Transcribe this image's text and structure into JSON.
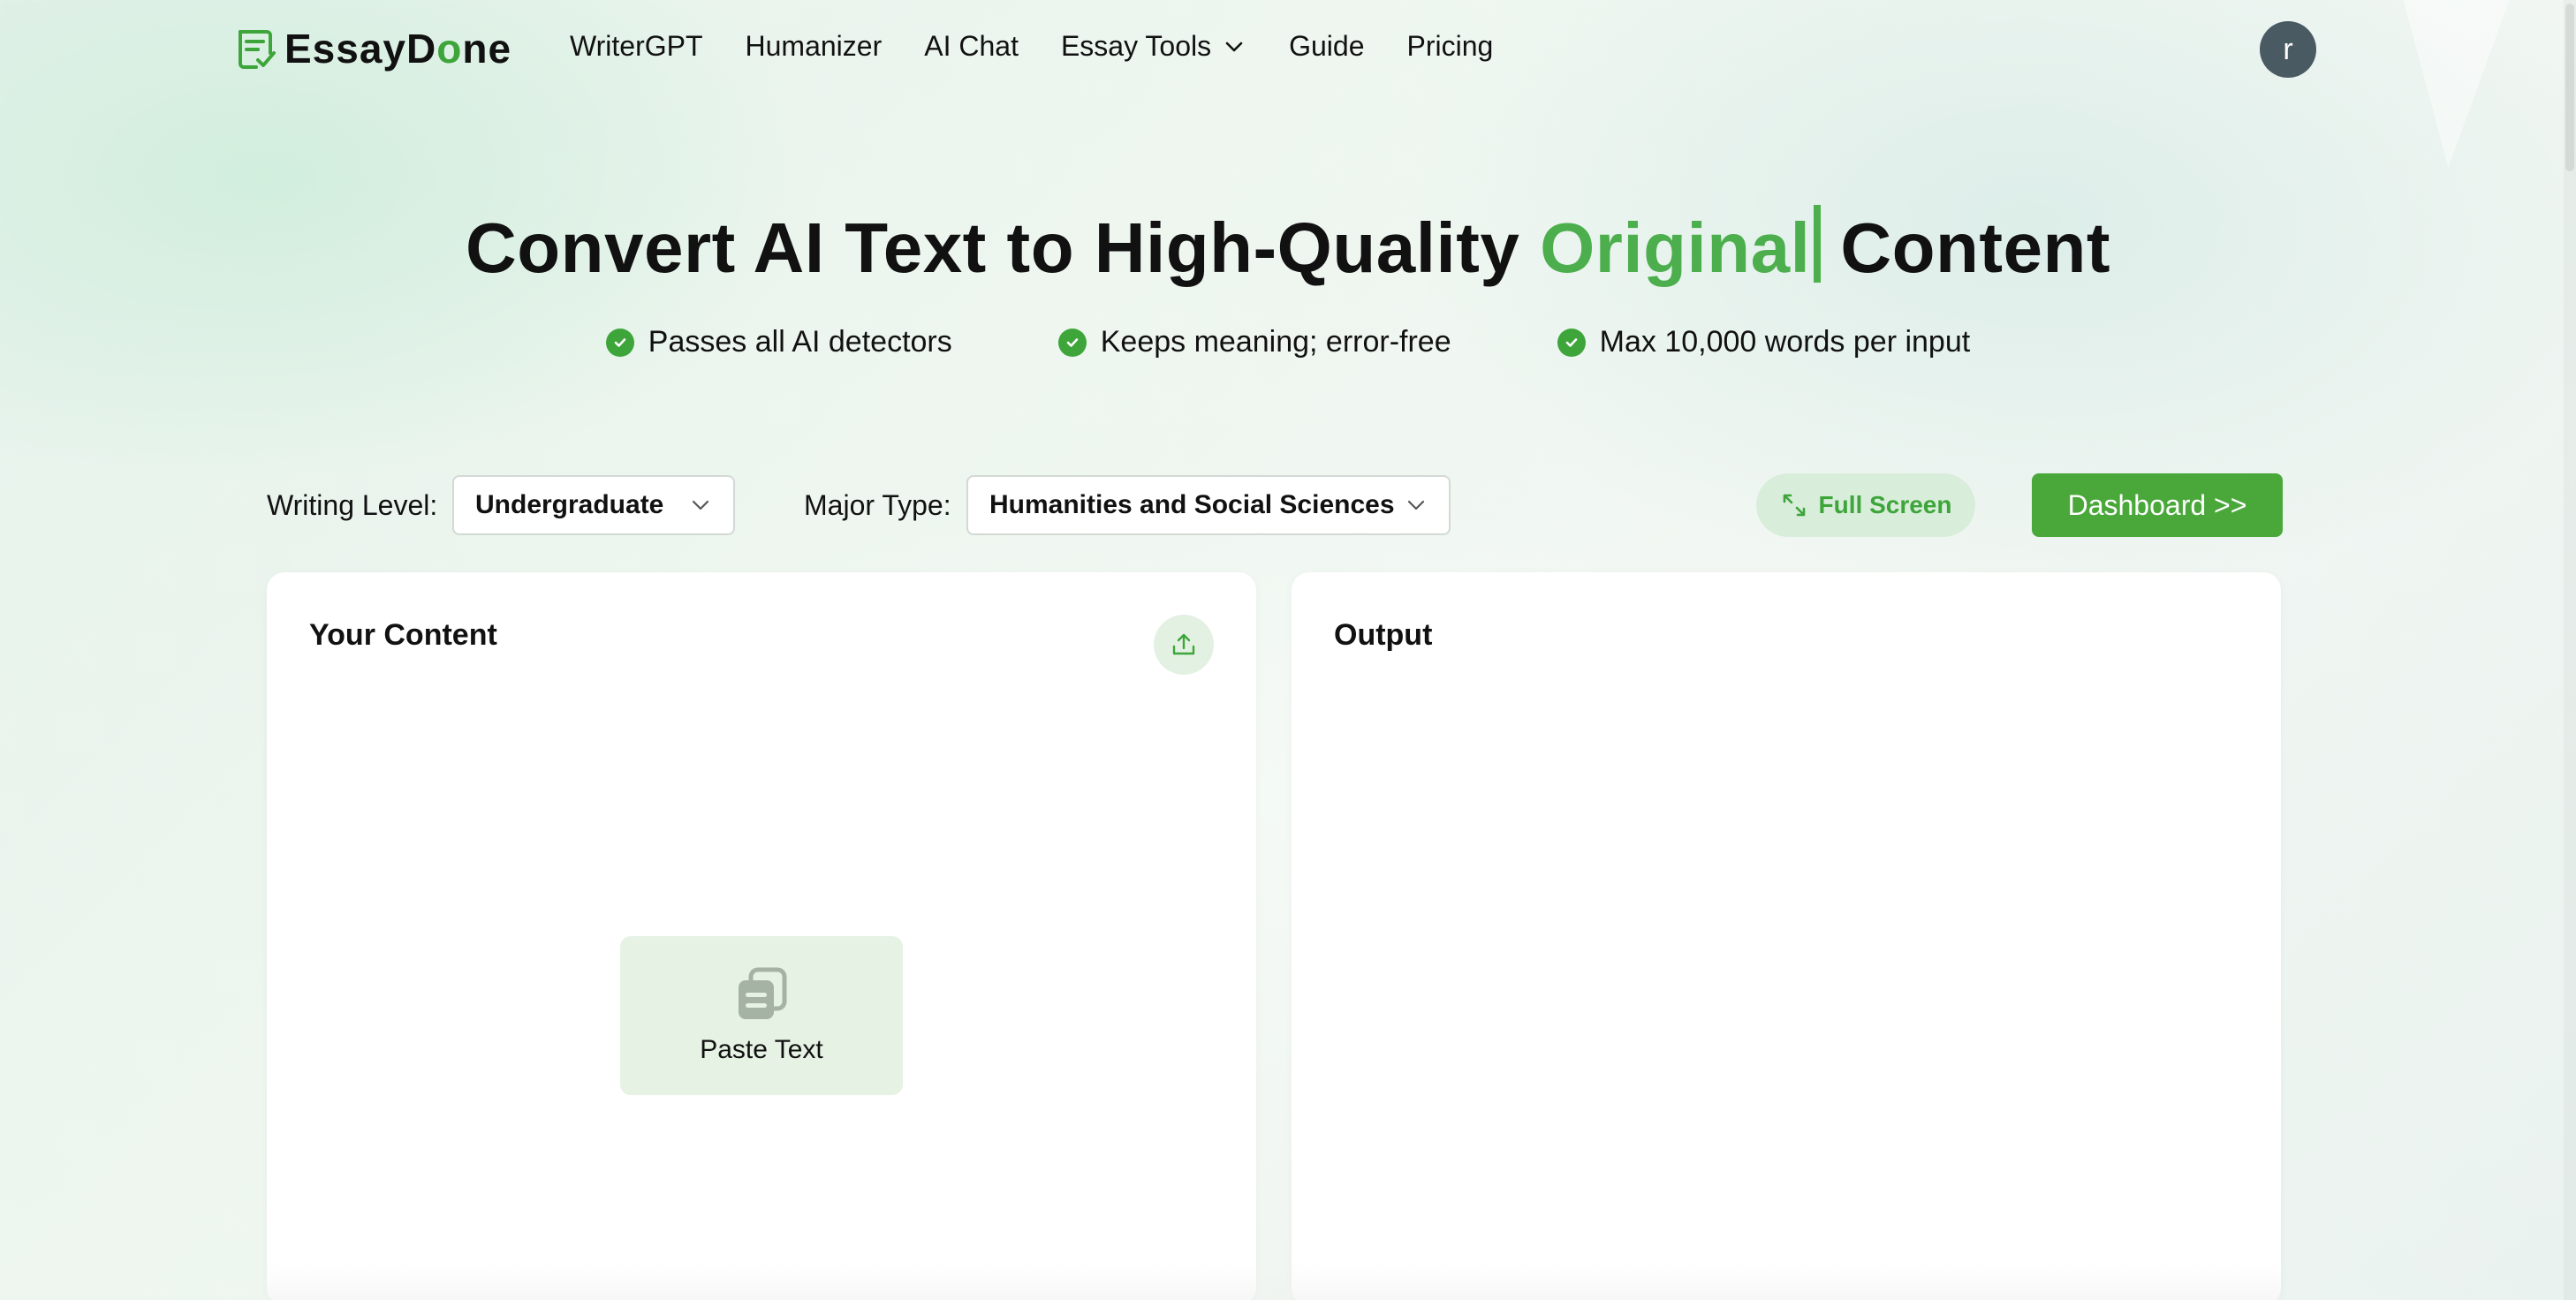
{
  "nav": {
    "logo_text_1": "EssayD",
    "logo_text_o": "o",
    "logo_text_2": "ne",
    "links": [
      {
        "label": "WriterGPT"
      },
      {
        "label": "Humanizer"
      },
      {
        "label": "AI Chat"
      },
      {
        "label": "Essay Tools",
        "icon": "chevron-down-icon"
      },
      {
        "label": "Guide"
      },
      {
        "label": "Pricing"
      }
    ],
    "avatar_letter": "r"
  },
  "hero": {
    "title_start": "Convert AI Text to High-Quality",
    "title_accent": "Original",
    "title_end": "Content",
    "features": [
      {
        "label": "Passes all AI detectors",
        "icon": "check-circle-icon"
      },
      {
        "label": "Keeps meaning; error-free",
        "icon": "check-circle-icon"
      },
      {
        "label": "Max 10,000 words per input",
        "icon": "check-circle-icon"
      }
    ]
  },
  "controls": {
    "writing_level_label": "Writing Level:",
    "writing_level_value": "Undergraduate",
    "major_type_label": "Major Type:",
    "major_type_value": "Humanities and Social Sciences",
    "fullscreen_label": "Full Screen",
    "dashboard_label": "Dashboard >>"
  },
  "panels": {
    "input_title": "Your Content",
    "paste_label": "Paste Text",
    "output_title": "Output"
  },
  "colors": {
    "accent": "#4cae4c",
    "button": "#4aa83a",
    "avatar": "#4a5a63"
  }
}
